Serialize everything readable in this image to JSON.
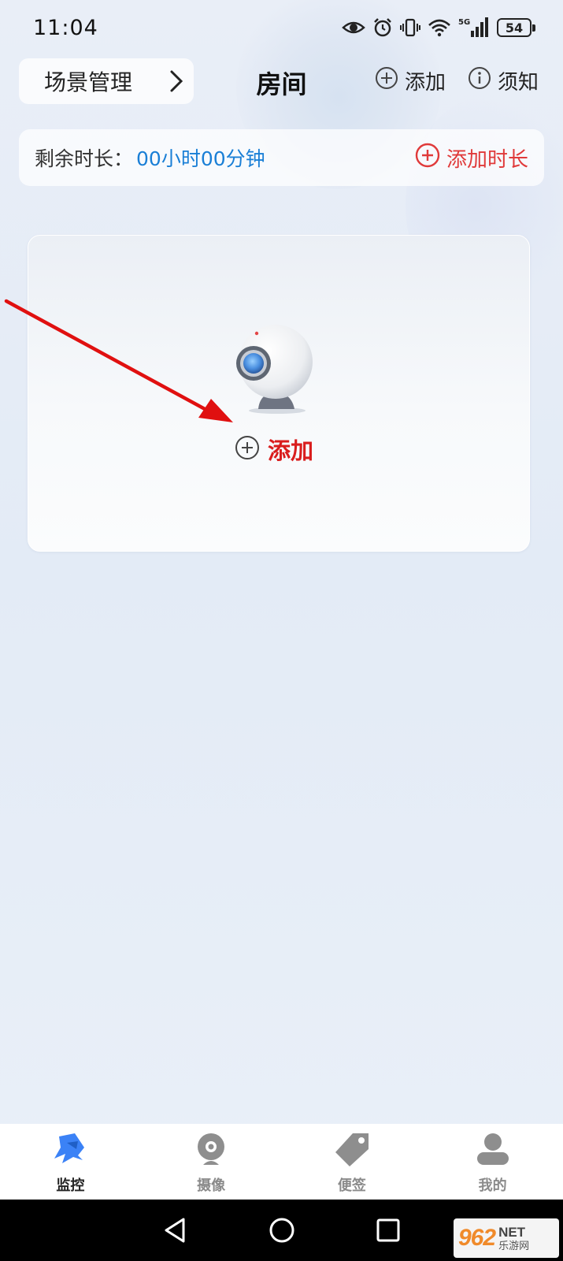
{
  "status_bar": {
    "time": "11:04",
    "network": "5G",
    "battery": "54",
    "icons": [
      "eye-icon",
      "alarm-icon",
      "vibrate-icon",
      "wifi-icon",
      "signal-icon",
      "battery-icon"
    ]
  },
  "header": {
    "scene_label": "场景管理",
    "title": "房间",
    "add_label": "添加",
    "notice_label": "须知"
  },
  "remain": {
    "label": "剩余时长：",
    "value": "00小时00分钟",
    "add_time_label": "添加时长"
  },
  "room_card": {
    "add_label": "添加"
  },
  "tabs": [
    {
      "label": "监控",
      "icon": "monitor-icon",
      "active": true
    },
    {
      "label": "摄像",
      "icon": "camera-icon",
      "active": false
    },
    {
      "label": "便签",
      "icon": "tag-icon",
      "active": false
    },
    {
      "label": "我的",
      "icon": "user-icon",
      "active": false
    }
  ],
  "watermark": {
    "number": "962",
    "net": "NET",
    "text": "乐游网"
  },
  "colors": {
    "accent_red": "#d91d1d",
    "link_blue": "#1a7fd6",
    "tab_active": "#3b82f6"
  }
}
